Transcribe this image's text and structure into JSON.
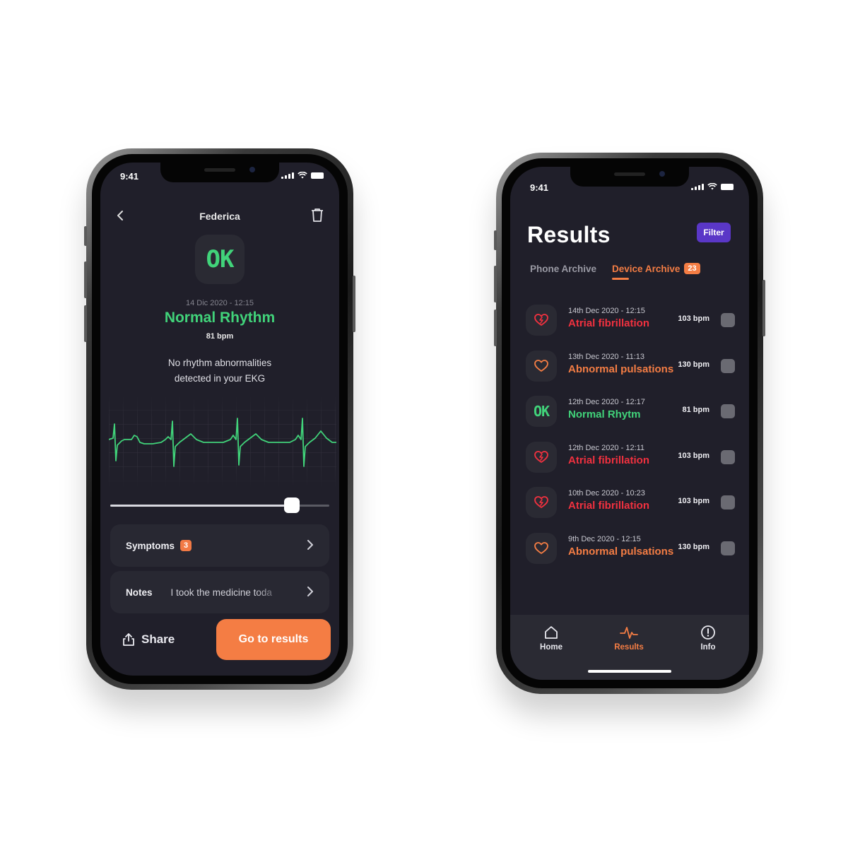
{
  "colors": {
    "accent_orange": "#f47d44",
    "ok_green": "#41d37a",
    "alert_red": "#f0313f",
    "filter_purple": "#5a37c7",
    "screen_bg": "#201f2a"
  },
  "left": {
    "status_time": "9:41",
    "header": {
      "back_icon": "chevron-left-icon",
      "title": "Federica",
      "delete_icon": "trash-icon"
    },
    "result": {
      "badge": "OK",
      "date": "14 Dic 2020 - 12:15",
      "status": "Normal Rhythm",
      "bpm": "81 bpm",
      "message_line1": "No rhythm abnormalities",
      "message_line2": "detected in your EKG"
    },
    "ekg_scrubber_position": 0.83,
    "symptoms": {
      "label": "Symptoms",
      "count": "3",
      "chevron_icon": "chevron-right-icon"
    },
    "notes": {
      "label": "Notes",
      "text": "I took the medicine toda",
      "chevron_icon": "chevron-right-icon"
    },
    "share_label": "Share",
    "share_icon": "share-icon",
    "go_to_results_label": "Go to results"
  },
  "right": {
    "status_time": "9:41",
    "title": "Results",
    "filter_label": "Filter",
    "tabs": [
      {
        "label": "Phone Archive",
        "active": false
      },
      {
        "label": "Device Archive",
        "active": true,
        "count": "23"
      }
    ],
    "items": [
      {
        "date": "14th Dec 2020 - 12:15",
        "label": "Atrial fibrillation",
        "bpm": "103 bpm",
        "icon": "heart-alert-icon",
        "kind": "afib"
      },
      {
        "date": "13th Dec 2020 - 11:13",
        "label": "Abnormal pulsations",
        "bpm": "130 bpm",
        "icon": "heart-outline-icon",
        "kind": "abnormal"
      },
      {
        "date": "12th Dec 2020 - 12:17",
        "label": "Normal Rhytm",
        "bpm": "81 bpm",
        "icon": "ok-icon",
        "icon_text": "OK",
        "kind": "normal"
      },
      {
        "date": "12th Dec 2020 - 12:11",
        "label": "Atrial fibrillation",
        "bpm": "103 bpm",
        "icon": "heart-alert-icon",
        "kind": "afib"
      },
      {
        "date": "10th Dec 2020 - 10:23",
        "label": "Atrial fibrillation",
        "bpm": "103 bpm",
        "icon": "heart-alert-icon",
        "kind": "afib"
      },
      {
        "date": "9th Dec 2020 - 12:15",
        "label": "Abnormal pulsations",
        "bpm": "130 bpm",
        "icon": "heart-outline-icon",
        "kind": "abnormal"
      }
    ],
    "nav": [
      {
        "label": "Home",
        "icon": "home-icon",
        "active": false
      },
      {
        "label": "Results",
        "icon": "pulse-icon",
        "active": true
      },
      {
        "label": "Info",
        "icon": "info-icon",
        "active": false
      }
    ]
  }
}
